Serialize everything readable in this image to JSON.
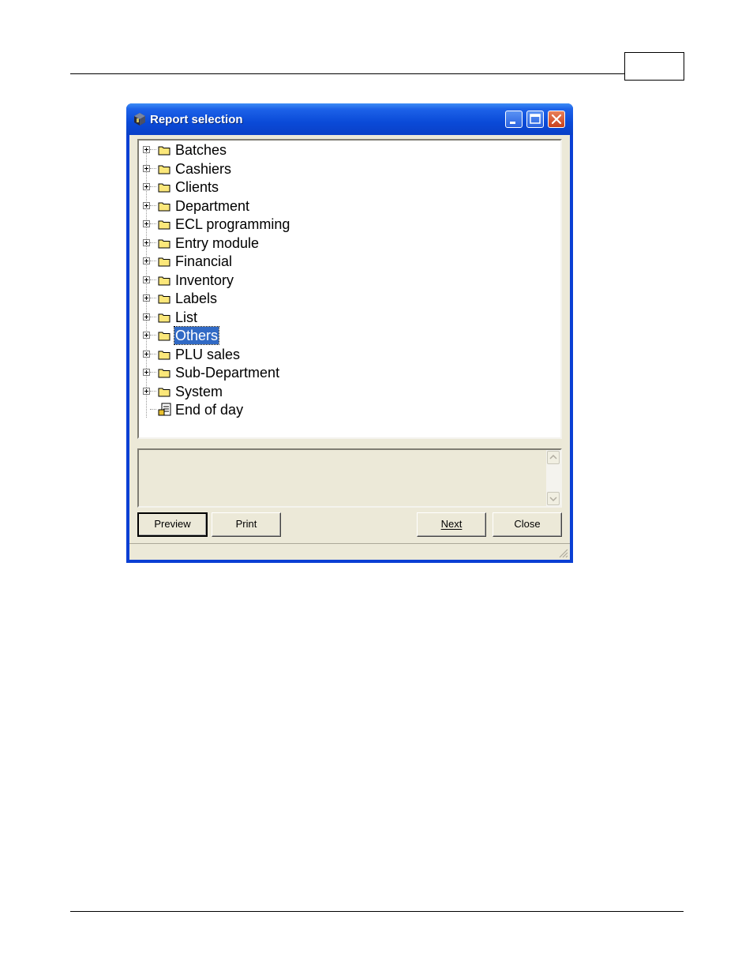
{
  "window": {
    "title": "Report selection",
    "controls": [
      "minimize-icon",
      "maximize-icon",
      "close-icon"
    ]
  },
  "tree": {
    "items": [
      {
        "label": "Batches",
        "type": "folder",
        "expandable": true
      },
      {
        "label": "Cashiers",
        "type": "folder",
        "expandable": true
      },
      {
        "label": "Clients",
        "type": "folder",
        "expandable": true
      },
      {
        "label": "Department",
        "type": "folder",
        "expandable": true
      },
      {
        "label": "ECL programming",
        "type": "folder",
        "expandable": true
      },
      {
        "label": "Entry module",
        "type": "folder",
        "expandable": true
      },
      {
        "label": "Financial",
        "type": "folder",
        "expandable": true
      },
      {
        "label": "Inventory",
        "type": "folder",
        "expandable": true
      },
      {
        "label": "Labels",
        "type": "folder",
        "expandable": true
      },
      {
        "label": "List",
        "type": "folder",
        "expandable": true
      },
      {
        "label": "Others",
        "type": "folder",
        "expandable": true,
        "selected": true
      },
      {
        "label": "PLU sales",
        "type": "folder",
        "expandable": true
      },
      {
        "label": "Sub-Department",
        "type": "folder",
        "expandable": true
      },
      {
        "label": "System",
        "type": "folder",
        "expandable": true
      },
      {
        "label": "End of day",
        "type": "report",
        "expandable": false
      }
    ]
  },
  "description": {
    "text": ""
  },
  "buttons": {
    "preview": "Preview",
    "print": "Print",
    "next": "Next",
    "close": "Close"
  },
  "colors": {
    "titlebar": "#0a4ad8",
    "selection": "#316ac5",
    "dialog_face": "#ece9d8"
  }
}
